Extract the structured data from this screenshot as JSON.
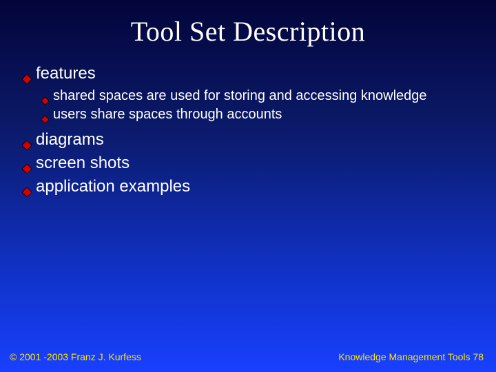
{
  "title": "Tool Set Description",
  "bullets": {
    "features": {
      "label": "features",
      "sub": {
        "a": "shared spaces are used for storing and accessing knowledge",
        "b": "users share spaces through accounts"
      }
    },
    "diagrams": {
      "label": "diagrams"
    },
    "screenshots": {
      "label": "screen shots"
    },
    "examples": {
      "label": "application examples"
    }
  },
  "footer": {
    "left": "© 2001 -2003 Franz J. Kurfess",
    "right_label": "Knowledge Management Tools ",
    "right_num": "78"
  },
  "colors": {
    "bullet_fill": "#d40000",
    "bullet_stroke": "#000000",
    "footer_text": "#ffe600"
  }
}
